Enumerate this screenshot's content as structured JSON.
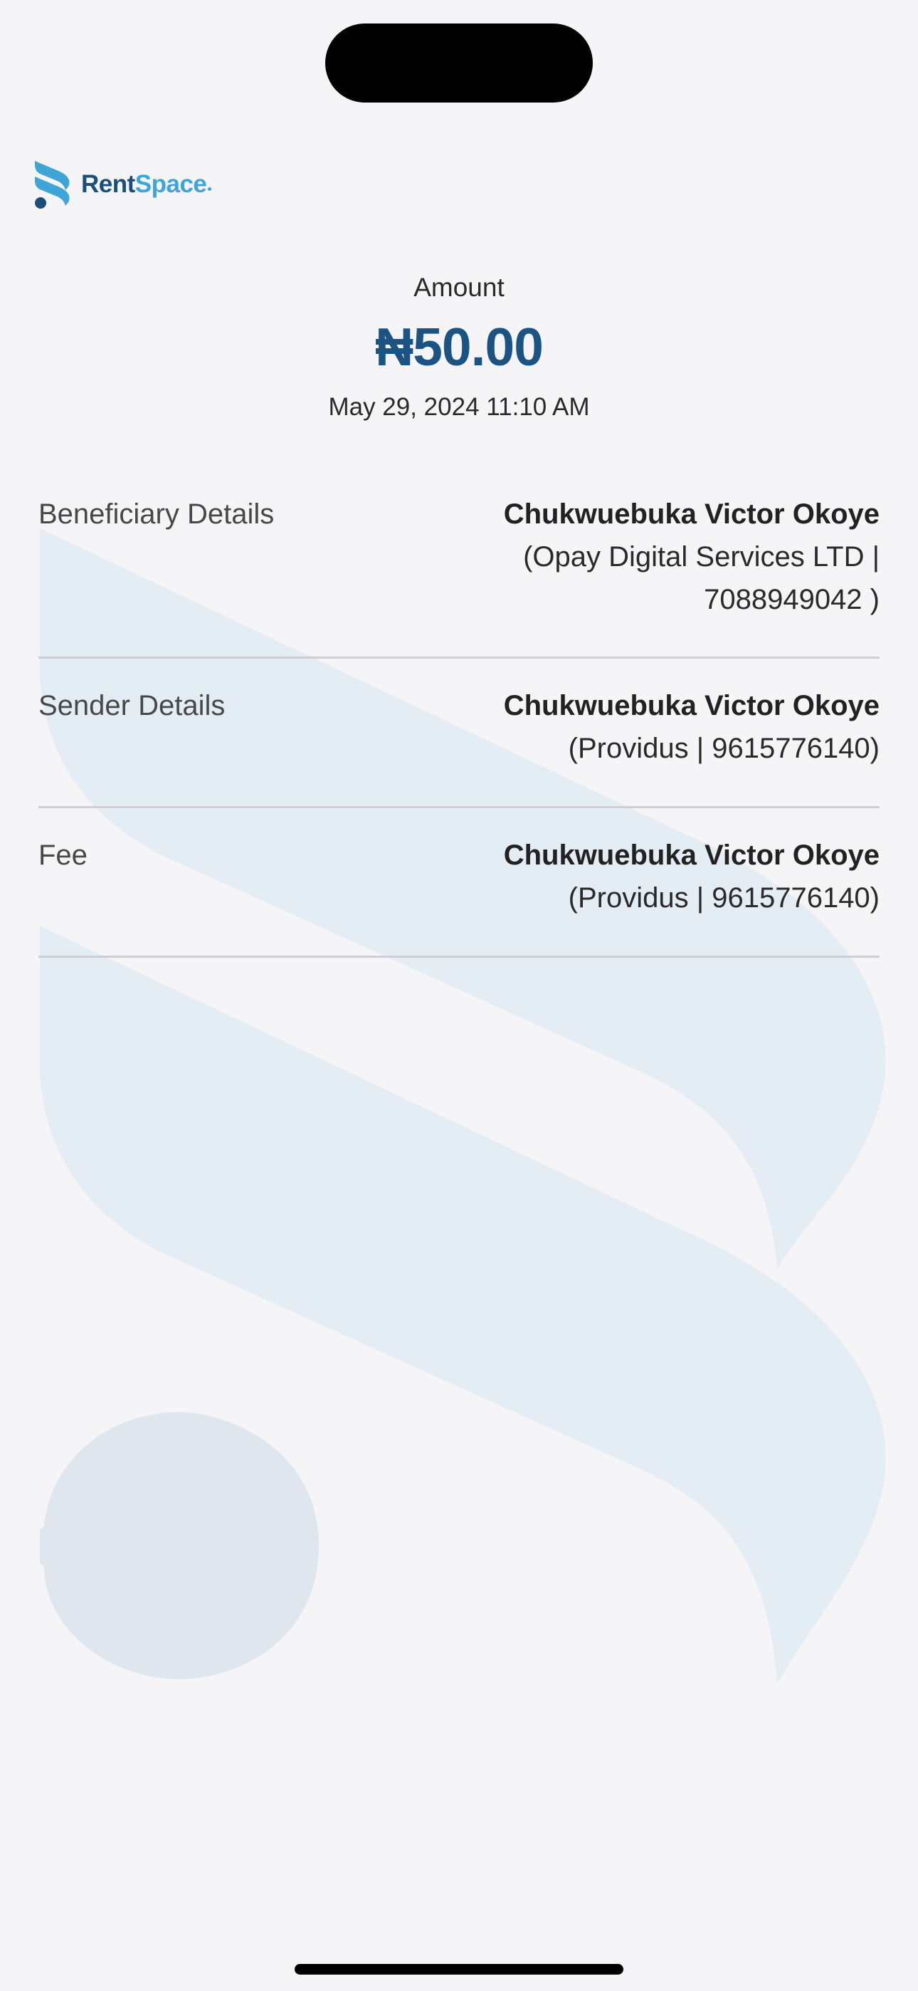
{
  "brand": {
    "logo_part1": "Rent",
    "logo_part2": "Space",
    "accent_color": "#1b5483",
    "secondary_color": "#3fa4d6"
  },
  "receipt": {
    "amount_label": "Amount",
    "amount_value": "₦50.00",
    "date": "May 29, 2024 11:10 AM"
  },
  "details": [
    {
      "label": "Beneficiary Details",
      "name": "Chukwuebuka Victor Okoye",
      "sub": "(Opay Digital Services LTD | 7088949042 )"
    },
    {
      "label": "Sender Details",
      "name": "Chukwuebuka Victor Okoye",
      "sub": "(Providus | 9615776140)"
    },
    {
      "label": "Fee",
      "name": "Chukwuebuka Victor Okoye",
      "sub": "(Providus | 9615776140)"
    }
  ],
  "watermark": {
    "icon": "rentspace-logo-watermark",
    "color": "#e4ecf4"
  }
}
